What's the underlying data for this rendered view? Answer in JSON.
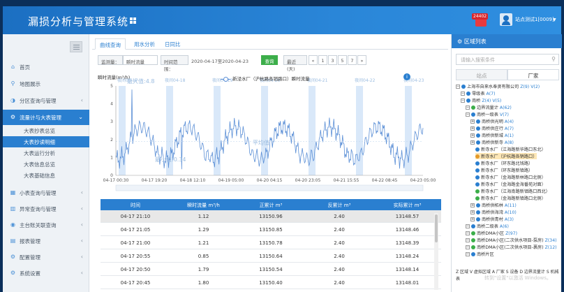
{
  "header": {
    "title": "漏损分析与管理系统",
    "badge": "24402",
    "username": "站点测试1[0009]"
  },
  "sidebar": {
    "items": [
      {
        "label": "首页",
        "icon": "home-icon",
        "glyph": "⌂"
      },
      {
        "label": "地图展示",
        "icon": "map-pin-icon",
        "glyph": "⚲"
      },
      {
        "label": "分区查询与管理",
        "icon": "partition-icon",
        "glyph": "◑"
      },
      {
        "label": "流量计与大表管理",
        "icon": "gear-icon",
        "glyph": "⚙"
      }
    ],
    "subitems": [
      {
        "label": "大表抄表总览"
      },
      {
        "label": "大表抄读明细"
      },
      {
        "label": "大表运行分析"
      },
      {
        "label": "大表信息总览"
      },
      {
        "label": "大表基础信息"
      }
    ],
    "items2": [
      {
        "label": "小表查询与管理",
        "icon": "meter-icon",
        "glyph": "▦"
      },
      {
        "label": "异常查询与管理",
        "icon": "bar-chart-icon",
        "glyph": "▥"
      },
      {
        "label": "主台账关联查询",
        "icon": "link-icon",
        "glyph": "◉"
      },
      {
        "label": "报表管理",
        "icon": "report-icon",
        "glyph": "▤"
      },
      {
        "label": "配置管理",
        "icon": "config-icon",
        "glyph": "⚙"
      },
      {
        "label": "系统设置",
        "icon": "settings-icon",
        "glyph": "⚙"
      }
    ]
  },
  "tabs": [
    "曲线查询",
    "用水分析",
    "日同比"
  ],
  "filter": {
    "monitor_label": "监测量：",
    "monitor_value": "瞬时流量",
    "time_label": "时间范围：",
    "time_value": "2020-04-17至2020-04-23",
    "query": "查询",
    "recent_label": "最近(天)",
    "pages": [
      "«",
      "1",
      "3",
      "5",
      "7",
      "»"
    ]
  },
  "chart_data": {
    "type": "line",
    "ylabel": "瞬时流量(m³/h)",
    "series": [
      {
        "name": "新泾水厂（沪杭路各销路口）瞬时流量"
      }
    ],
    "x_ticks": [
      "04-17 00:30",
      "04-17 19:20",
      "04-18 12:10",
      "04-19 05:00",
      "04-20 04:15",
      "04-20 23:05",
      "04-21 15:55",
      "04-22 08:45",
      "04-23 05:00"
    ],
    "band_labels": [
      "夜间04-17",
      "夜间04-18",
      "夜间04-19",
      "夜间04-20",
      "夜间04-21",
      "夜间04-22",
      "夜间04-23"
    ],
    "max_label": "最大值:4.8",
    "avg_label": "平均值",
    "min_label": "最小值:0.34",
    "ylim": [
      0,
      5
    ],
    "max": 4.8,
    "min": 0.34
  },
  "table": {
    "headers": [
      "时间",
      "瞬时流量 m³/h",
      "正累计 m³",
      "反累计 m³",
      "实际累计 m³"
    ],
    "rows": [
      [
        "04-17 21:10",
        "1.12",
        "13150.96",
        "2.40",
        "13148.57"
      ],
      [
        "04-17 21:05",
        "1.29",
        "13150.85",
        "2.40",
        "13148.46"
      ],
      [
        "04-17 21:00",
        "1.21",
        "13150.78",
        "2.40",
        "13148.39"
      ],
      [
        "04-17 20:55",
        "0.85",
        "13150.64",
        "2.40",
        "13148.24"
      ],
      [
        "04-17 20:50",
        "1.79",
        "13150.54",
        "2.40",
        "13148.14"
      ],
      [
        "04-17 20:45",
        "1.80",
        "13150.40",
        "2.40",
        "13148.01"
      ]
    ]
  },
  "right": {
    "title": "区域列表",
    "search_placeholder": "请输入搜索条件",
    "tabs": [
      "站点",
      "厂家"
    ],
    "tree": [
      {
        "t": "上海市自来水奉贤有限公司",
        "c": "Z(9) V(2)",
        "d": 0,
        "col": "#2a7fd0"
      },
      {
        "t": "零级表",
        "c": "A(7)",
        "d": 1,
        "col": "#2a7fd0"
      },
      {
        "t": "南桥",
        "c": "Z(4) V(5)",
        "d": 1,
        "col": "#2a7fd0"
      },
      {
        "t": "边界流量计",
        "c": "A(62)",
        "d": 2,
        "col": "#3cae4a"
      },
      {
        "t": "南桥一级表",
        "c": "V(7)",
        "d": 2,
        "col": "#2a7fd0"
      },
      {
        "t": "南桥供光明",
        "c": "A(4)",
        "d": 3,
        "col": "#2a7fd0"
      },
      {
        "t": "南桥供庄行",
        "c": "A(7)",
        "d": 3,
        "col": "#2a7fd0"
      },
      {
        "t": "南桥供新城",
        "c": "A(1)",
        "d": 3,
        "col": "#2a7fd0"
      },
      {
        "t": "南桥供新寺",
        "c": "A(8)",
        "d": 3,
        "col": "#2a7fd0"
      },
      {
        "t": "新寺水厂（江海路新华路口东北）",
        "c": "",
        "d": 4,
        "col": "#2a7fd0"
      },
      {
        "t": "新寺水厂（沪杭路各销路口）",
        "c": "",
        "d": 4,
        "col": "#e49a2b",
        "sel": true
      },
      {
        "t": "新寺水厂（环东路北钱路）",
        "c": "",
        "d": 4,
        "col": "#2a7fd0"
      },
      {
        "t": "新寺水厂（环东路新镇路）",
        "c": "",
        "d": 4,
        "col": "#2a7fd0"
      },
      {
        "t": "新寺水厂（金海路新林路口北侧）",
        "c": "",
        "d": 4,
        "col": "#2a7fd0"
      },
      {
        "t": "新寺水厂（金海路金海番苑对面）",
        "c": "",
        "d": 4,
        "col": "#2a7fd0"
      },
      {
        "t": "新寺水厂（江海南路新镇路口西北）",
        "c": "",
        "d": 4,
        "col": "#3cae4a"
      },
      {
        "t": "新寺水厂（金海路新镇路口北侧）",
        "c": "",
        "d": 4,
        "col": "#3cae4a"
      },
      {
        "t": "南桥供柘林",
        "c": "A(11)",
        "d": 3,
        "col": "#2a7fd0"
      },
      {
        "t": "南桥供海湾",
        "c": "A(10)",
        "d": 3,
        "col": "#2a7fd0"
      },
      {
        "t": "南桥供青村",
        "c": "A(3)",
        "d": 3,
        "col": "#2a7fd0"
      },
      {
        "t": "南桥二级表",
        "c": "A(6)",
        "d": 2,
        "col": "#2a7fd0"
      },
      {
        "t": "南桥DMA小区",
        "c": "Z(97)",
        "d": 2,
        "col": "#3cae4a"
      },
      {
        "t": "南桥DMA小区(二次供水项目-泵房)",
        "c": "Z(34)",
        "d": 2,
        "col": "#3cae4a"
      },
      {
        "t": "南桥DMA小区(二次供水项目-裹房)",
        "c": "Z(12)",
        "d": 2,
        "col": "#3cae4a"
      },
      {
        "t": "南桥片区",
        "c": "",
        "d": 2,
        "col": "#2a7fd0"
      }
    ],
    "legend": "Z 区域  V 虚拟区域  A 厂家  S 设备  D 边界流量计  S 机械表",
    "watermark": "转到\"设置\"以激活 Windows。"
  }
}
